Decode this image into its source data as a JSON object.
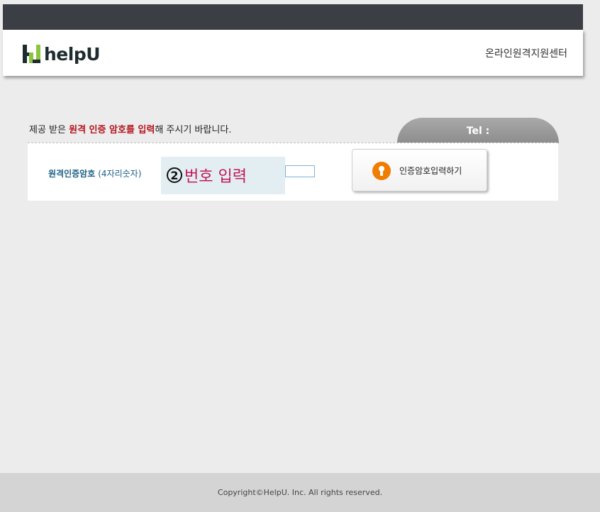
{
  "header": {
    "logo_text": "helpU",
    "title": "온라인원격지원센터"
  },
  "instruction": {
    "part1": "제공 받은 ",
    "highlight": "원격 인증 암호를 입력",
    "part2": "해 주시기 바랍니다."
  },
  "tel": {
    "label": "Tel :"
  },
  "form": {
    "label": "원격인증암호",
    "hint": "(4자리숫자)",
    "input_value": "",
    "input_placeholder": "",
    "submit_label": "인증암호입력하기"
  },
  "annotation": {
    "step": "②",
    "text": "번호 입력"
  },
  "footer": {
    "copyright": "Copyright©HelpU. Inc. All rights reserved."
  },
  "colors": {
    "topbar": "#3b3e44",
    "highlight_red": "#b3141e",
    "label_blue": "#1d5f86",
    "logo_green": "#8bc53f",
    "icon_orange": "#f07d00",
    "annotation_pink": "#c2185b"
  },
  "icons": {
    "logo": "helpu-logo-icon",
    "submit": "keyhole-icon"
  }
}
